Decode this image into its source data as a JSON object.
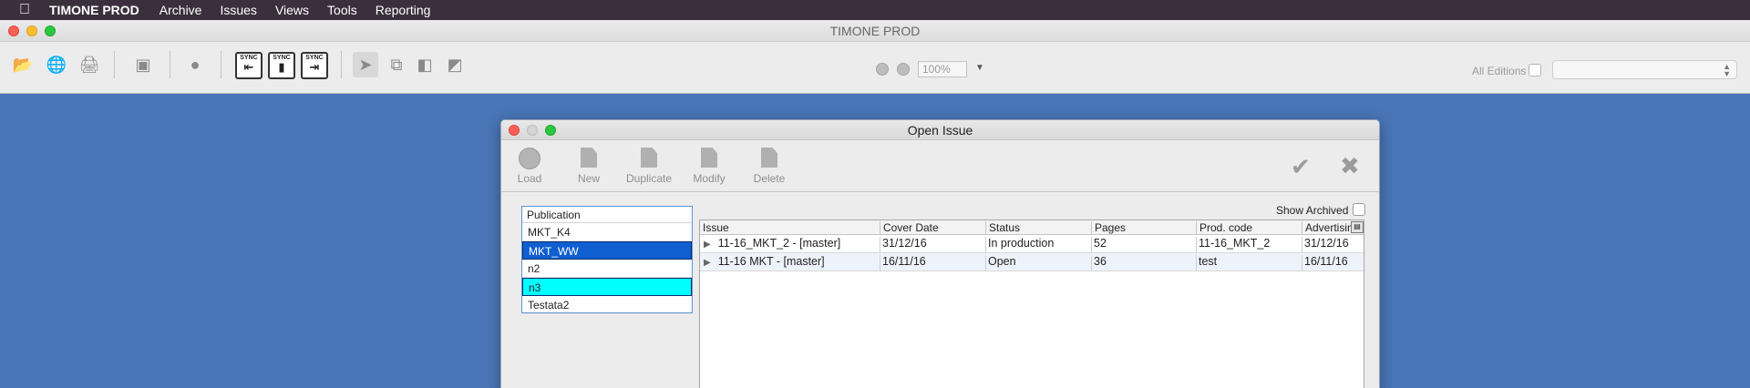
{
  "menubar": {
    "app_name": "TIMONE PROD",
    "menus": [
      "Archive",
      "Issues",
      "Views",
      "Tools",
      "Reporting"
    ]
  },
  "main_window": {
    "title": "TIMONE PROD",
    "zoom_value": "100%",
    "editions_label": "All Editions",
    "editions_select_value": ""
  },
  "dialog": {
    "title": "Open Issue",
    "buttons": {
      "load": "Load",
      "new": "New",
      "duplicate": "Duplicate",
      "modify": "Modify",
      "delete": "Delete"
    },
    "show_archived_label": "Show Archived",
    "publication": {
      "header": "Publication",
      "items": [
        "MKT_K4",
        "MKT_WW",
        "n2",
        "n3",
        "Testata2"
      ]
    },
    "issue_table": {
      "columns": [
        "Issue",
        "Cover Date",
        "Status",
        "Pages",
        "Prod. code",
        "Advertising"
      ],
      "rows": [
        {
          "issue": "11-16_MKT_2 - [master]",
          "cover_date": "31/12/16",
          "status": "In production",
          "pages": "52",
          "prod_code": "11-16_MKT_2",
          "advertising": "31/12/16"
        },
        {
          "issue": "11-16 MKT - [master]",
          "cover_date": "16/11/16",
          "status": "Open",
          "pages": "36",
          "prod_code": "test",
          "advertising": "16/11/16"
        }
      ]
    }
  },
  "icons": {
    "apple": "apple-logo-icon",
    "sync": "sync-icon",
    "confirm": "checkmark-icon",
    "cancel": "close-x-icon"
  },
  "colors": {
    "desktop": "#4a76b8",
    "selection_blue": "#0f5fd1",
    "selection_cyan": "#00ffff",
    "menubar": "#3b2f3d"
  }
}
